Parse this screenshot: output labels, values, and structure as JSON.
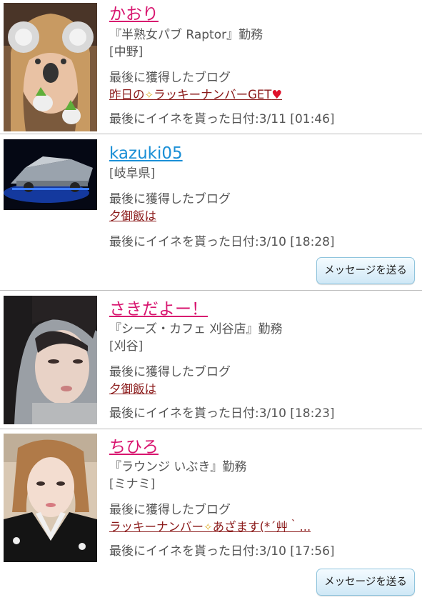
{
  "users": [
    {
      "name": "かおり",
      "shop": "『半熟女パブ Raptor』勤務",
      "area": "[中野]",
      "blog_heading": "最後に獲得したブログ",
      "blog_title_a": "昨日の",
      "blog_title_b": "ラッキーナンバーGET",
      "liked": "最後にイイネを貰った日付:3/11 [01:46]"
    },
    {
      "name": "kazuki05",
      "area": "[岐阜県]",
      "blog_heading": "最後に獲得したブログ",
      "blog_title": "夕御飯は",
      "liked": "最後にイイネを貰った日付:3/10 [18:28]",
      "message_button": "メッセージを送る"
    },
    {
      "name": "さきだよー！",
      "shop": "『シーズ・カフェ 刈谷店』勤務",
      "area": "[刈谷]",
      "blog_heading": "最後に獲得したブログ",
      "blog_title": "夕御飯は",
      "liked": "最後にイイネを貰った日付:3/10 [18:23]"
    },
    {
      "name": "ちひろ",
      "shop": "『ラウンジ いぶき』勤務",
      "area": "[ミナミ]",
      "blog_heading": "最後に獲得したブログ",
      "blog_title_a": "ラッキーナンバー",
      "blog_title_b": "あざます(*´艸｀...",
      "liked": "最後にイイネを貰った日付:3/10 [17:56]",
      "message_button": "メッセージを送る"
    }
  ],
  "icons": {
    "sparkle": "✧",
    "heart": "♥"
  }
}
